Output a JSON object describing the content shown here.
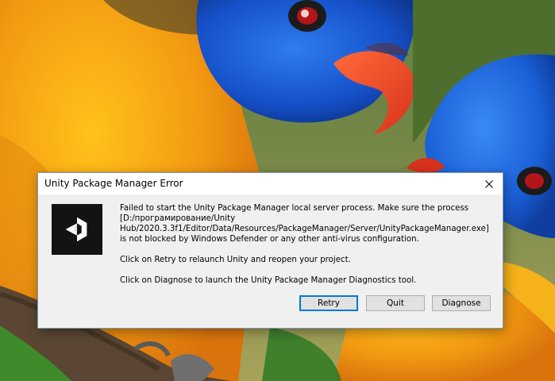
{
  "window": {
    "title": "Unity Package Manager Error",
    "close_icon": "close-icon"
  },
  "dialog": {
    "icon": "unity-logo-icon",
    "message_lines": [
      "Failed to start the Unity Package Manager local server process. Make sure the process",
      "[D:/програмирование/Unity",
      "Hub/2020.3.3f1/Editor/Data/Resources/PackageManager/Server/UnityPackageManager.exe]",
      "is not blocked by Windows Defender or any other anti-virus configuration."
    ],
    "retry_hint": "Click on Retry to relaunch Unity and reopen your project.",
    "diagnose_hint": "Click on Diagnose to launch the Unity Package Manager Diagnostics tool."
  },
  "buttons": {
    "retry": "Retry",
    "quit": "Quit",
    "diagnose": "Diagnose"
  },
  "colors": {
    "accent": "#0078d7",
    "dialog_bg": "#f0f0f0",
    "icon_bg": "#131313"
  }
}
